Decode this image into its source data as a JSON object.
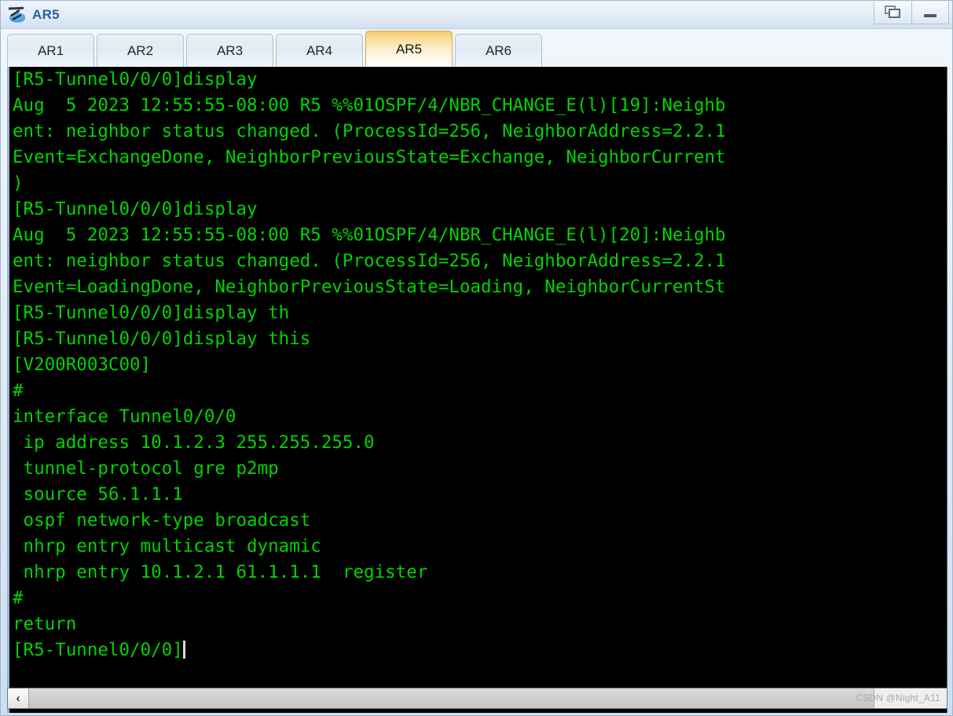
{
  "window": {
    "title": "AR5",
    "icon": "router-icon",
    "buttons": [
      {
        "name": "restore-button",
        "label": "Restore"
      },
      {
        "name": "minimize-button",
        "label": "Minimize"
      }
    ]
  },
  "tabs": [
    {
      "label": "AR1",
      "active": false
    },
    {
      "label": "AR2",
      "active": false
    },
    {
      "label": "AR3",
      "active": false
    },
    {
      "label": "AR4",
      "active": false
    },
    {
      "label": "AR5",
      "active": true
    },
    {
      "label": "AR6",
      "active": false
    }
  ],
  "terminal": {
    "foreground": "#00d400",
    "background": "#000000",
    "cursor_visible": true,
    "lines": [
      "[R5-Tunnel0/0/0]display",
      "Aug  5 2023 12:55:55-08:00 R5 %%01OSPF/4/NBR_CHANGE_E(l)[19]:Neighb",
      "ent: neighbor status changed. (ProcessId=256, NeighborAddress=2.2.1",
      "Event=ExchangeDone, NeighborPreviousState=Exchange, NeighborCurrent",
      ")",
      "[R5-Tunnel0/0/0]display",
      "Aug  5 2023 12:55:55-08:00 R5 %%01OSPF/4/NBR_CHANGE_E(l)[20]:Neighb",
      "ent: neighbor status changed. (ProcessId=256, NeighborAddress=2.2.1",
      "Event=LoadingDone, NeighborPreviousState=Loading, NeighborCurrentSt",
      "[R5-Tunnel0/0/0]display th",
      "[R5-Tunnel0/0/0]display this",
      "[V200R003C00]",
      "#",
      "interface Tunnel0/0/0",
      " ip address 10.1.2.3 255.255.255.0",
      " tunnel-protocol gre p2mp",
      " source 56.1.1.1",
      " ospf network-type broadcast",
      " nhrp entry multicast dynamic",
      " nhrp entry 10.1.2.1 61.1.1.1  register",
      "#",
      "return"
    ],
    "prompt_line": "[R5-Tunnel0/0/0]"
  },
  "scrollbar": {
    "left_arrow": "‹",
    "name": "horizontal-scrollbar"
  },
  "watermark": {
    "text": "CSDN @Night_A11"
  }
}
